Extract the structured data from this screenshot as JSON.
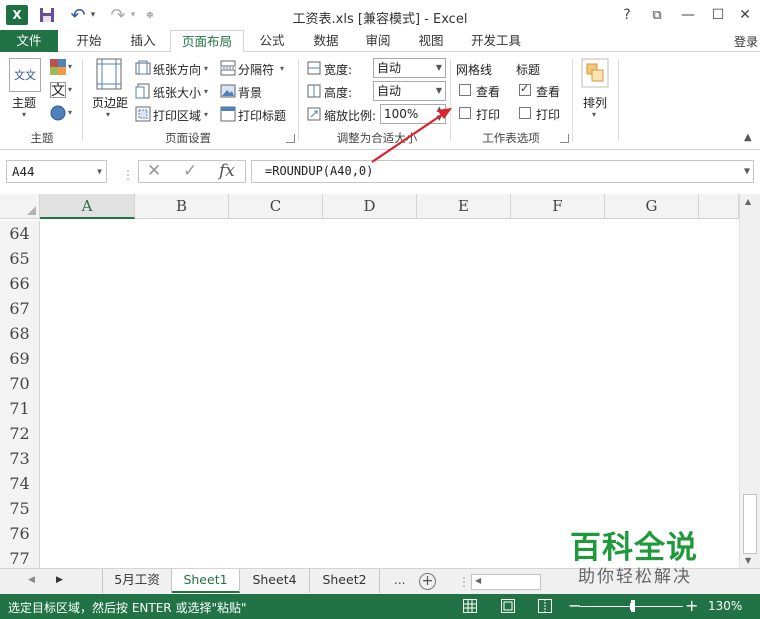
{
  "window": {
    "title": "工资表.xls  [兼容模式] - Excel",
    "logo": "X",
    "help": "?",
    "restore": "⧉",
    "minimize": "—",
    "maximize": "☐",
    "close": "✕"
  },
  "quick_access": {
    "undo": "↶",
    "redo": "↷",
    "dropdown": "▾",
    "customize": "≑"
  },
  "tabs": [
    {
      "label": "文件"
    },
    {
      "label": "开始"
    },
    {
      "label": "插入"
    },
    {
      "label": "页面布局"
    },
    {
      "label": "公式"
    },
    {
      "label": "数据"
    },
    {
      "label": "审阅"
    },
    {
      "label": "视图"
    },
    {
      "label": "开发工具"
    }
  ],
  "login": "登录",
  "ribbon": {
    "themes": {
      "theme_label": "主题",
      "group_label": "主题",
      "theme_icon_text": "文文",
      "fonts_icon_text": "文"
    },
    "page_setup": {
      "margins": "页边距",
      "orientation": "纸张方向",
      "size": "纸张大小",
      "print_area": "打印区域",
      "breaks": "分隔符",
      "background": "背景",
      "print_titles": "打印标题",
      "group_label": "页面设置"
    },
    "scale": {
      "width_label": "宽度:",
      "width_value": "自动",
      "height_label": "高度:",
      "height_value": "自动",
      "scale_label": "缩放比例:",
      "scale_value": "100%",
      "group_label": "调整为合适大小"
    },
    "sheet_options": {
      "gridlines_header": "网格线",
      "headings_header": "标题",
      "view_label": "查看",
      "print_label": "打印",
      "group_label": "工作表选项",
      "gridlines_view_checked": false,
      "gridlines_print_checked": false,
      "headings_view_checked": true,
      "headings_print_checked": false
    },
    "arrange": {
      "label": "排列"
    }
  },
  "formula_bar": {
    "name_box": "A44",
    "cancel": "✕",
    "enter": "✓",
    "fx": "fx",
    "formula": "=ROUNDUP(A40,0)"
  },
  "grid": {
    "columns": [
      "A",
      "B",
      "C",
      "D",
      "E",
      "F",
      "G"
    ],
    "selected_column": "A",
    "rows": [
      "64",
      "65",
      "66",
      "67",
      "68",
      "69",
      "70",
      "71",
      "72",
      "73",
      "74",
      "75",
      "76",
      "77"
    ]
  },
  "sheets": {
    "tabs": [
      {
        "label": "5月工资",
        "active": false
      },
      {
        "label": "Sheet1",
        "active": true
      },
      {
        "label": "Sheet4",
        "active": false
      },
      {
        "label": "Sheet2",
        "active": false
      }
    ],
    "more": "...",
    "add": "+",
    "next": "▶",
    "prev": "◀"
  },
  "watermark": {
    "title": "百科全说",
    "subtitle": "助你轻松解决"
  },
  "status": {
    "message": "选定目标区域，然后按 ENTER 或选择\"粘贴\"",
    "zoom_minus": "−",
    "zoom_plus": "+",
    "zoom": "130%",
    "zoom_value": 130
  },
  "colors": {
    "excel_green": "#217346",
    "annotation_red": "#d9232d",
    "watermark_green": "#1f9a3b"
  }
}
